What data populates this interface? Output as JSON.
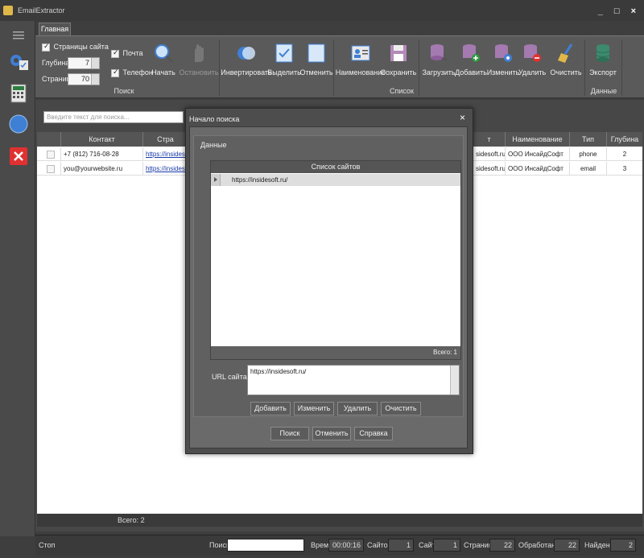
{
  "window": {
    "title": "EmailExtractor",
    "controls": [
      "_",
      "□",
      "×"
    ]
  },
  "ribbon": {
    "tab": "Главная",
    "search_group": {
      "label": "Поиск",
      "site_pages": {
        "label": "Страницы сайта",
        "checked": true
      },
      "depth": {
        "label": "Глубина:",
        "value": "7"
      },
      "pages": {
        "label": "Страниц:",
        "value": "70"
      },
      "email": {
        "label": "Почта",
        "checked": true
      },
      "phone": {
        "label": "Телефон",
        "checked": true
      },
      "start": "Начать",
      "stop": "Остановить"
    },
    "list_group": {
      "label": "Список",
      "invert": "Инвертировать",
      "select": "Выделить",
      "cancel": "Отменить",
      "name": "Наименование",
      "save": "Сохранить",
      "load": "Загрузить",
      "add": "Добавить",
      "edit": "Изменить",
      "delete": "Удалить",
      "clear": "Очистить"
    },
    "data_group": {
      "label": "Данные",
      "export": "Экспорт"
    }
  },
  "main": {
    "search_placeholder": "Введите текст для поиска...",
    "columns": {
      "contact": "Контакт",
      "page": "Стра",
      "site": "т",
      "name": "Наименование",
      "type": "Тип",
      "depth": "Глубина"
    },
    "rows": [
      {
        "contact": "+7 (812) 716-08-28",
        "page": "https://insidesoft",
        "site": "sidesoft.ru/",
        "name": "ООО ИнсайдСофт",
        "type": "phone",
        "depth": "2"
      },
      {
        "contact": "you@yourwebsite.ru",
        "page": "https://insidesoft",
        "site": "sidesoft.ru/",
        "name": "ООО ИнсайдСофт",
        "type": "email",
        "depth": "3"
      }
    ],
    "total": "Всего: 2"
  },
  "dialog": {
    "title": "Начало поиска",
    "group_title": "Данные",
    "sites_header": "Список сайтов",
    "sites": [
      "https://insidesoft.ru/"
    ],
    "sites_total": "Всего: 1",
    "url_label": "URL сайта *:",
    "url_value": "https://insidesoft.ru/",
    "buttons": {
      "add": "Добавить",
      "edit": "Изменить",
      "delete": "Удалить",
      "clear": "Очистить",
      "search": "Поиск",
      "cancel": "Отменить",
      "help": "Справка"
    }
  },
  "status": {
    "stop": "Стоп",
    "search_label": "Поиск",
    "time_label": "Время",
    "time": "00:00:16",
    "sites_label": "Сайтов",
    "sites": "1",
    "site_label": "Сайт",
    "site": "1",
    "pages_label": "Страниц",
    "pages": "22",
    "processed_label": "Обработано",
    "processed": "22",
    "found_label": "Найдено",
    "found": "2"
  },
  "colors": {
    "background": "#3e3e3e",
    "ribbon": "#5a5a5a",
    "link": "#1a3aa8",
    "delete_red": "#e03030"
  }
}
